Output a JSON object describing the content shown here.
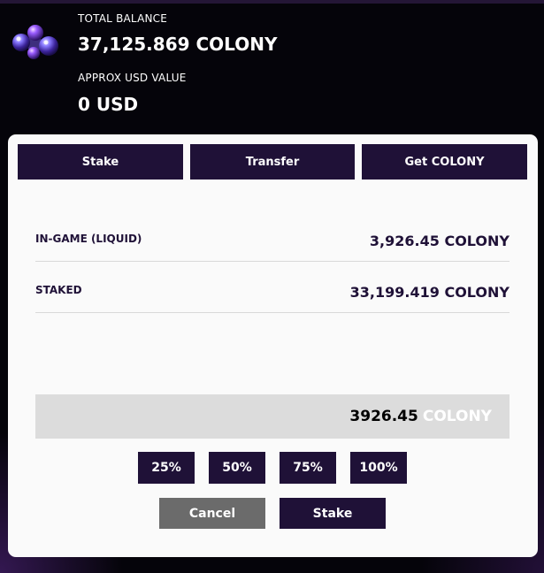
{
  "header": {
    "total_balance_label": "TOTAL BALANCE",
    "total_balance_value": "37,125.869 COLONY",
    "usd_label": "APPROX USD VALUE",
    "usd_value": "0 USD",
    "token_icon": "colony-token-icon"
  },
  "tabs": [
    {
      "label": "Stake"
    },
    {
      "label": "Transfer"
    },
    {
      "label": "Get COLONY"
    }
  ],
  "balances": [
    {
      "label": "IN-GAME (LIQUID)",
      "value": "3,926.45 COLONY"
    },
    {
      "label": "STAKED",
      "value": "33,199.419 COLONY"
    }
  ],
  "amount": {
    "value": "3926.45",
    "unit": "COLONY"
  },
  "percent_buttons": [
    {
      "label": "25%"
    },
    {
      "label": "50%"
    },
    {
      "label": "75%"
    },
    {
      "label": "100%"
    }
  ],
  "actions": {
    "cancel_label": "Cancel",
    "stake_label": "Stake"
  },
  "colors": {
    "primary": "#1f1137",
    "card": "#fafafa",
    "cancel": "#6b6b6b",
    "input_bg": "#dcdcdc",
    "background": "#05040a"
  }
}
